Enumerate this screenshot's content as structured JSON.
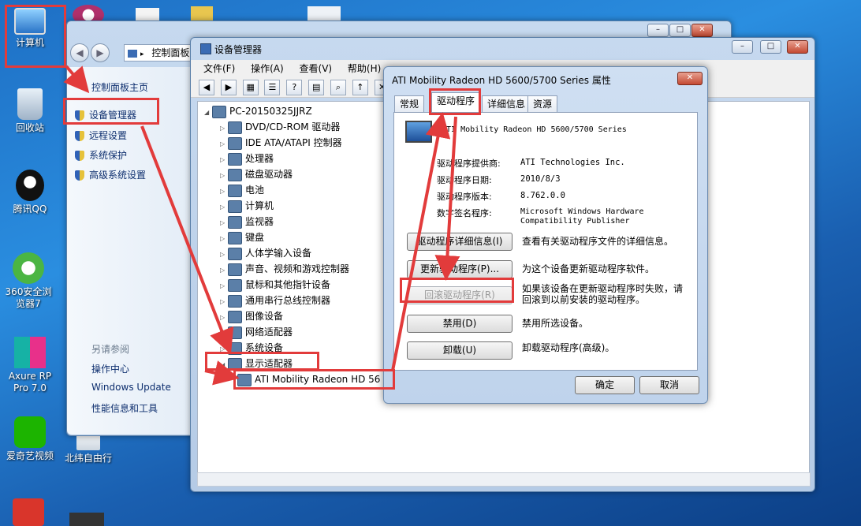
{
  "desktop": {
    "icons": [
      {
        "label": "计算机"
      },
      {
        "label": "回收站"
      },
      {
        "label": "腾讯QQ"
      },
      {
        "label": "360安全浏览器7"
      },
      {
        "label": "Axure RP Pro 7.0"
      },
      {
        "label": "爱奇艺视频"
      },
      {
        "label": "北纬自由行"
      }
    ]
  },
  "control_panel": {
    "address": "控制面板",
    "home_link": "控制面板主页",
    "links": [
      "设备管理器",
      "远程设置",
      "系统保护",
      "高级系统设置"
    ],
    "see_also_title": "另请参阅",
    "see_also": [
      "操作中心",
      "Windows Update",
      "性能信息和工具"
    ]
  },
  "device_manager": {
    "title": "设备管理器",
    "menu": [
      "文件(F)",
      "操作(A)",
      "查看(V)",
      "帮助(H)"
    ],
    "root": "PC-20150325JJRZ",
    "categories": [
      "DVD/CD-ROM 驱动器",
      "IDE ATA/ATAPI 控制器",
      "处理器",
      "磁盘驱动器",
      "电池",
      "计算机",
      "监视器",
      "键盘",
      "人体学输入设备",
      "声音、视频和游戏控制器",
      "鼠标和其他指针设备",
      "通用串行总线控制器",
      "图像设备",
      "网络适配器",
      "系统设备",
      "显示适配器"
    ],
    "child_device": "ATI Mobility Radeon HD 56"
  },
  "dialog": {
    "title": "ATI Mobility Radeon HD 5600/5700 Series 属性",
    "tabs": [
      "常规",
      "驱动程序",
      "详细信息",
      "资源"
    ],
    "device_name": "ATI Mobility Radeon HD 5600/5700 Series",
    "props": [
      {
        "label": "驱动程序提供商:",
        "value": "ATI Technologies Inc."
      },
      {
        "label": "驱动程序日期:",
        "value": "2010/8/3"
      },
      {
        "label": "驱动程序版本:",
        "value": "8.762.0.0"
      },
      {
        "label": "数字签名程序:",
        "value": "Microsoft Windows Hardware Compatibility Publisher"
      }
    ],
    "buttons": [
      {
        "label": "驱动程序详细信息(I)",
        "desc": "查看有关驱动程序文件的详细信息。"
      },
      {
        "label": "更新驱动程序(P)...",
        "desc": "为这个设备更新驱动程序软件。"
      },
      {
        "label": "回滚驱动程序(R)",
        "desc": "如果该设备在更新驱动程序时失败，请回滚到以前安装的驱动程序。"
      },
      {
        "label": "禁用(D)",
        "desc": "禁用所选设备。"
      },
      {
        "label": "卸载(U)",
        "desc": "卸载驱动程序(高级)。"
      }
    ],
    "ok": "确定",
    "cancel": "取消"
  },
  "colors": {
    "annotation": "#e23b3b"
  }
}
